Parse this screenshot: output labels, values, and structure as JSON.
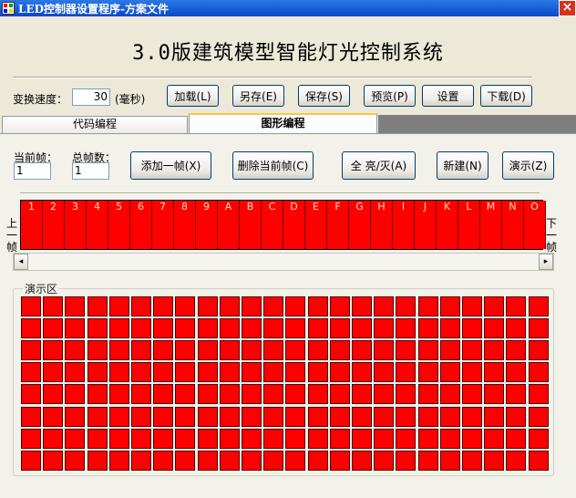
{
  "window": {
    "title": "LED控制器设置程序-方案文件",
    "close_label": "×",
    "icon_colors": [
      "#ff0000",
      "#00a000",
      "#0000ff",
      "#ffcc00"
    ]
  },
  "headline": "3.0版建筑模型智能灯光控制系统",
  "toolbar": {
    "speed_label": "变换速度：",
    "speed_value": "30",
    "speed_unit": "(毫秒)",
    "buttons": [
      "加载(L)",
      "另存(E)",
      "保存(S)",
      "预览(P)",
      "设置",
      "下载(D)"
    ]
  },
  "tabs": [
    {
      "label": "代码编程",
      "active": false
    },
    {
      "label": "图形编程",
      "active": true
    }
  ],
  "frame_controls": {
    "current_frame_label": "当前帧：",
    "current_frame_value": "1",
    "total_frames_label": "总帧数：",
    "total_frames_value": "1",
    "buttons": [
      "添加一帧(X)",
      "删除当前帧(C)",
      "全 亮/灭(A)",
      "新建(N)",
      "演示(Z)"
    ]
  },
  "frame_strip": {
    "prev_label": [
      "上",
      "一",
      "帧"
    ],
    "next_label": [
      "下",
      "一",
      "帧"
    ],
    "frames": [
      "1",
      "2",
      "3",
      "4",
      "5",
      "6",
      "7",
      "8",
      "9",
      "A",
      "B",
      "C",
      "D",
      "E",
      "F",
      "G",
      "H",
      "I",
      "J",
      "K",
      "L",
      "M",
      "N",
      "O"
    ],
    "fill_color": "#ff0000"
  },
  "scrollbar": {
    "left_icon": "◂",
    "right_icon": "▸"
  },
  "demo_area": {
    "label": "演示区",
    "rows": 8,
    "cols": 24,
    "led_color": "#ff0000"
  }
}
